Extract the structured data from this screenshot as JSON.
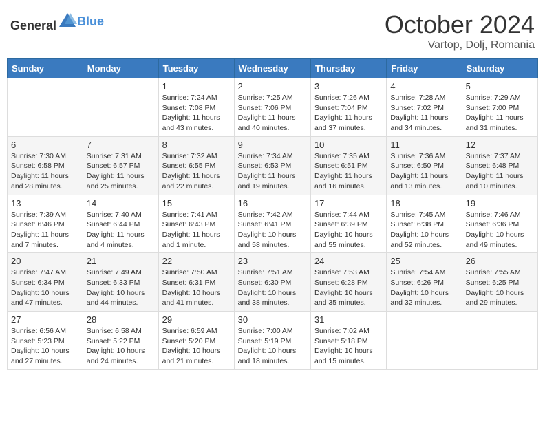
{
  "header": {
    "logo_general": "General",
    "logo_blue": "Blue",
    "month": "October 2024",
    "location": "Vartop, Dolj, Romania"
  },
  "weekdays": [
    "Sunday",
    "Monday",
    "Tuesday",
    "Wednesday",
    "Thursday",
    "Friday",
    "Saturday"
  ],
  "weeks": [
    [
      {
        "day": "",
        "text": ""
      },
      {
        "day": "",
        "text": ""
      },
      {
        "day": "1",
        "text": "Sunrise: 7:24 AM\nSunset: 7:08 PM\nDaylight: 11 hours and 43 minutes."
      },
      {
        "day": "2",
        "text": "Sunrise: 7:25 AM\nSunset: 7:06 PM\nDaylight: 11 hours and 40 minutes."
      },
      {
        "day": "3",
        "text": "Sunrise: 7:26 AM\nSunset: 7:04 PM\nDaylight: 11 hours and 37 minutes."
      },
      {
        "day": "4",
        "text": "Sunrise: 7:28 AM\nSunset: 7:02 PM\nDaylight: 11 hours and 34 minutes."
      },
      {
        "day": "5",
        "text": "Sunrise: 7:29 AM\nSunset: 7:00 PM\nDaylight: 11 hours and 31 minutes."
      }
    ],
    [
      {
        "day": "6",
        "text": "Sunrise: 7:30 AM\nSunset: 6:58 PM\nDaylight: 11 hours and 28 minutes."
      },
      {
        "day": "7",
        "text": "Sunrise: 7:31 AM\nSunset: 6:57 PM\nDaylight: 11 hours and 25 minutes."
      },
      {
        "day": "8",
        "text": "Sunrise: 7:32 AM\nSunset: 6:55 PM\nDaylight: 11 hours and 22 minutes."
      },
      {
        "day": "9",
        "text": "Sunrise: 7:34 AM\nSunset: 6:53 PM\nDaylight: 11 hours and 19 minutes."
      },
      {
        "day": "10",
        "text": "Sunrise: 7:35 AM\nSunset: 6:51 PM\nDaylight: 11 hours and 16 minutes."
      },
      {
        "day": "11",
        "text": "Sunrise: 7:36 AM\nSunset: 6:50 PM\nDaylight: 11 hours and 13 minutes."
      },
      {
        "day": "12",
        "text": "Sunrise: 7:37 AM\nSunset: 6:48 PM\nDaylight: 11 hours and 10 minutes."
      }
    ],
    [
      {
        "day": "13",
        "text": "Sunrise: 7:39 AM\nSunset: 6:46 PM\nDaylight: 11 hours and 7 minutes."
      },
      {
        "day": "14",
        "text": "Sunrise: 7:40 AM\nSunset: 6:44 PM\nDaylight: 11 hours and 4 minutes."
      },
      {
        "day": "15",
        "text": "Sunrise: 7:41 AM\nSunset: 6:43 PM\nDaylight: 11 hours and 1 minute."
      },
      {
        "day": "16",
        "text": "Sunrise: 7:42 AM\nSunset: 6:41 PM\nDaylight: 10 hours and 58 minutes."
      },
      {
        "day": "17",
        "text": "Sunrise: 7:44 AM\nSunset: 6:39 PM\nDaylight: 10 hours and 55 minutes."
      },
      {
        "day": "18",
        "text": "Sunrise: 7:45 AM\nSunset: 6:38 PM\nDaylight: 10 hours and 52 minutes."
      },
      {
        "day": "19",
        "text": "Sunrise: 7:46 AM\nSunset: 6:36 PM\nDaylight: 10 hours and 49 minutes."
      }
    ],
    [
      {
        "day": "20",
        "text": "Sunrise: 7:47 AM\nSunset: 6:34 PM\nDaylight: 10 hours and 47 minutes."
      },
      {
        "day": "21",
        "text": "Sunrise: 7:49 AM\nSunset: 6:33 PM\nDaylight: 10 hours and 44 minutes."
      },
      {
        "day": "22",
        "text": "Sunrise: 7:50 AM\nSunset: 6:31 PM\nDaylight: 10 hours and 41 minutes."
      },
      {
        "day": "23",
        "text": "Sunrise: 7:51 AM\nSunset: 6:30 PM\nDaylight: 10 hours and 38 minutes."
      },
      {
        "day": "24",
        "text": "Sunrise: 7:53 AM\nSunset: 6:28 PM\nDaylight: 10 hours and 35 minutes."
      },
      {
        "day": "25",
        "text": "Sunrise: 7:54 AM\nSunset: 6:26 PM\nDaylight: 10 hours and 32 minutes."
      },
      {
        "day": "26",
        "text": "Sunrise: 7:55 AM\nSunset: 6:25 PM\nDaylight: 10 hours and 29 minutes."
      }
    ],
    [
      {
        "day": "27",
        "text": "Sunrise: 6:56 AM\nSunset: 5:23 PM\nDaylight: 10 hours and 27 minutes."
      },
      {
        "day": "28",
        "text": "Sunrise: 6:58 AM\nSunset: 5:22 PM\nDaylight: 10 hours and 24 minutes."
      },
      {
        "day": "29",
        "text": "Sunrise: 6:59 AM\nSunset: 5:20 PM\nDaylight: 10 hours and 21 minutes."
      },
      {
        "day": "30",
        "text": "Sunrise: 7:00 AM\nSunset: 5:19 PM\nDaylight: 10 hours and 18 minutes."
      },
      {
        "day": "31",
        "text": "Sunrise: 7:02 AM\nSunset: 5:18 PM\nDaylight: 10 hours and 15 minutes."
      },
      {
        "day": "",
        "text": ""
      },
      {
        "day": "",
        "text": ""
      }
    ]
  ]
}
